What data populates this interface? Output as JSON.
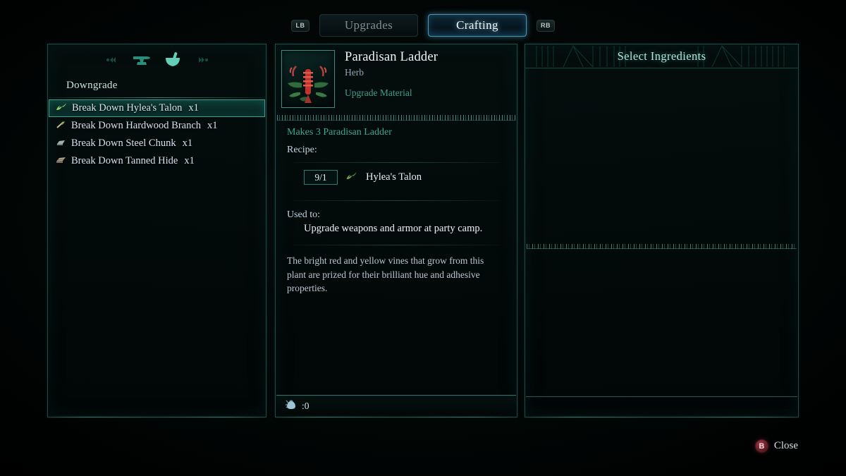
{
  "tabbar": {
    "left_bumper": "LB",
    "right_bumper": "RB",
    "tabs": [
      {
        "label": "Upgrades",
        "active": false
      },
      {
        "label": "Crafting",
        "active": true
      }
    ]
  },
  "left_panel": {
    "category_icons": [
      "left-arrows-icon",
      "anvil-icon",
      "mortar-pestle-icon",
      "right-arrows-icon"
    ],
    "section_label": "Downgrade",
    "rows": [
      {
        "icon": "herb-leaf-icon",
        "label": "Break Down Hylea's Talon",
        "qty": "x1",
        "selected": true
      },
      {
        "icon": "wood-branch-icon",
        "label": "Break Down Hardwood Branch",
        "qty": "x1",
        "selected": false
      },
      {
        "icon": "steel-ingot-icon",
        "label": "Break Down Steel Chunk",
        "qty": "x1",
        "selected": false
      },
      {
        "icon": "tanned-hide-icon",
        "label": "Break Down Tanned Hide",
        "qty": "x1",
        "selected": false
      }
    ]
  },
  "detail_panel": {
    "thumbnail_icon": "paradisan-ladder-plant-icon",
    "item_name": "Paradisan Ladder",
    "item_type": "Herb",
    "item_category": "Upgrade Material",
    "makes": "Makes 3 Paradisan Ladder",
    "recipe_label": "Recipe:",
    "ingredients": [
      {
        "quantity": "9/1",
        "icon": "herb-leaf-icon",
        "name": "Hylea's Talon"
      }
    ],
    "used_to_label": "Used to:",
    "used_to_text": "Upgrade weapons and armor at party camp.",
    "flavor_text": "The bright red and yellow vines that grow from this plant are prized for their brilliant hue and adhesive properties.",
    "money_icon": "coin-pouch-icon",
    "money_value": ":0"
  },
  "ingredients_panel": {
    "title": "Select Ingredients"
  },
  "footer": {
    "close_button_glyph": "B",
    "close_label": "Close"
  },
  "colors": {
    "accent_teal": "#3fa692",
    "accent_blue": "#4c95b8",
    "panel_border": "#1d4a44",
    "text_primary": "#eef3f9",
    "text_muted": "#93a6b5",
    "close_red": "#a03640"
  }
}
